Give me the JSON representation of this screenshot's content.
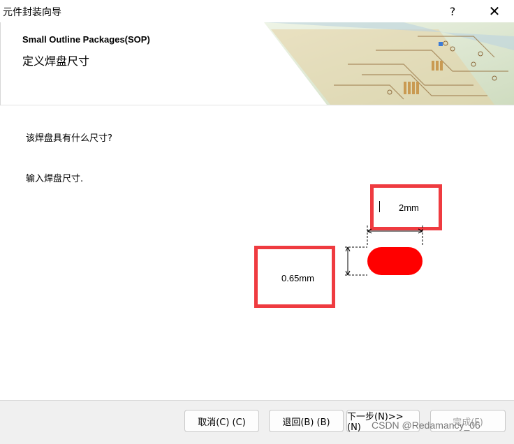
{
  "window": {
    "title": "元件封装向导",
    "help_label": "?",
    "close_label": "✕"
  },
  "header": {
    "title": "Small Outline Packages(SOP)",
    "subtitle": "定义焊盘尺寸"
  },
  "content": {
    "question": "该焊盘具有什么尺寸?",
    "instruction": "输入焊盘尺寸.",
    "pad_width_value": "2mm",
    "pad_height_value": "0.65mm"
  },
  "colors": {
    "pad": "#ff0000",
    "highlight": "#ef3b40"
  },
  "footer": {
    "cancel_label": "取消(C) (C)",
    "back_label": "退回(B) (B)",
    "next_label": "下一步(N)>> (N)",
    "finish_label": "完成(F)"
  },
  "watermark": "CSDN @Redamancy_06"
}
